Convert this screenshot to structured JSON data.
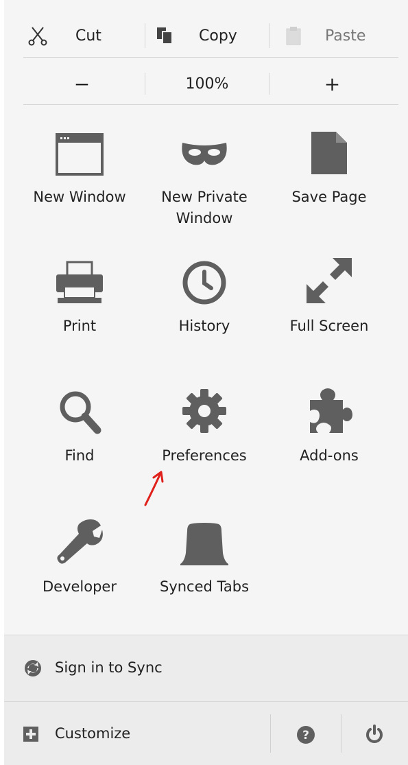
{
  "edit": {
    "cut_label": "Cut",
    "copy_label": "Copy",
    "paste_label": "Paste"
  },
  "zoom": {
    "minus_label": "−",
    "level": "100%",
    "plus_label": "+"
  },
  "items": [
    {
      "label": "New Window",
      "icon": "new-window-icon"
    },
    {
      "label": "New Private\nWindow",
      "icon": "private-mask-icon"
    },
    {
      "label": "Save Page",
      "icon": "save-page-icon"
    },
    {
      "label": "Print",
      "icon": "printer-icon"
    },
    {
      "label": "History",
      "icon": "clock-icon"
    },
    {
      "label": "Full Screen",
      "icon": "fullscreen-arrows-icon"
    },
    {
      "label": "Find",
      "icon": "magnifier-icon"
    },
    {
      "label": "Preferences",
      "icon": "gear-icon"
    },
    {
      "label": "Add-ons",
      "icon": "puzzle-icon"
    },
    {
      "label": "Developer",
      "icon": "wrench-icon"
    },
    {
      "label": "Synced Tabs",
      "icon": "synced-tabs-icon"
    }
  ],
  "footer": {
    "sync_label": "Sign in to Sync",
    "customize_label": "Customize"
  },
  "colors": {
    "icon": "#5f5f5f",
    "annotation": "#e0201b"
  }
}
